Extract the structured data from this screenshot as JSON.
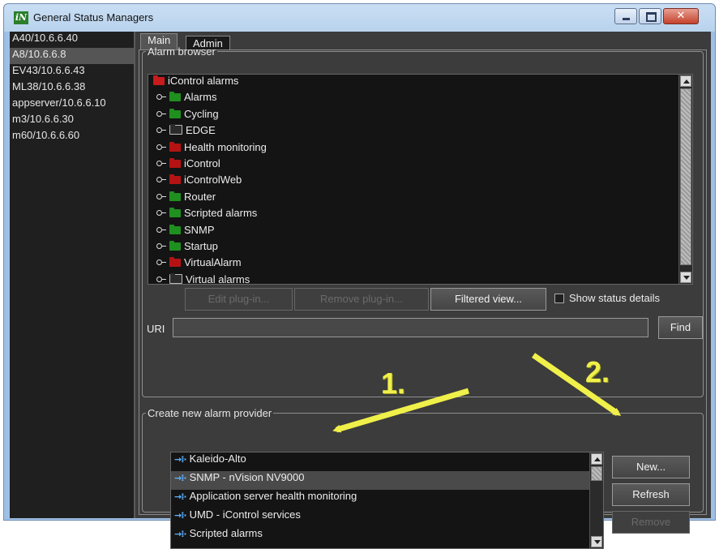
{
  "window": {
    "title": "General Status Managers",
    "app_icon": "iN"
  },
  "title_buttons": {
    "minimize": "minimize-icon",
    "maximize": "maximize-icon",
    "close": "close-icon"
  },
  "sidebar": {
    "items": [
      {
        "label": "A40/10.6.6.40"
      },
      {
        "label": "A8/10.6.6.8"
      },
      {
        "label": "EV43/10.6.6.43"
      },
      {
        "label": "ML38/10.6.6.38"
      },
      {
        "label": "appserver/10.6.6.10"
      },
      {
        "label": "m3/10.6.6.30"
      },
      {
        "label": "m60/10.6.6.60"
      }
    ],
    "selected": "A8/10.6.6.8"
  },
  "tabs": [
    {
      "label": "Main"
    },
    {
      "label": "Admin"
    }
  ],
  "browser": {
    "legend": "Alarm browser",
    "root": {
      "label": "iControl alarms",
      "color": "#c81b1b"
    },
    "items": [
      {
        "label": "Alarms",
        "color": "#1f8f1f"
      },
      {
        "label": "Cycling",
        "color": "#1f8f1f"
      },
      {
        "label": "EDGE",
        "color": "#2b2b2b"
      },
      {
        "label": "Health monitoring",
        "color": "#b51313"
      },
      {
        "label": "iControl",
        "color": "#b51313"
      },
      {
        "label": "iControlWeb",
        "color": "#b51313"
      },
      {
        "label": "Router",
        "color": "#1f8f1f"
      },
      {
        "label": "Scripted alarms",
        "color": "#1f8f1f"
      },
      {
        "label": "SNMP",
        "color": "#1f8f1f"
      },
      {
        "label": "Startup",
        "color": "#1f8f1f"
      },
      {
        "label": "VirtualAlarm",
        "color": "#b51313"
      },
      {
        "label": "Virtual alarms",
        "color": "#2b2b2b"
      }
    ],
    "buttons": {
      "edit": "Edit plug-in...",
      "remove": "Remove plug-in...",
      "filtered": "Filtered view..."
    },
    "show_status_details": {
      "label": "Show status details",
      "checked": false
    },
    "uri": {
      "label": "URI",
      "value": ""
    },
    "find": "Find"
  },
  "create": {
    "legend": "Create new alarm provider",
    "providers": [
      {
        "label": "Kaleido-Alto"
      },
      {
        "label": "SNMP - nVision NV9000"
      },
      {
        "label": "Application server health monitoring"
      },
      {
        "label": "UMD - iControl services"
      },
      {
        "label": "Scripted alarms"
      }
    ],
    "selected": "SNMP - nVision NV9000",
    "buttons": {
      "new": "New...",
      "refresh": "Refresh",
      "remove": "Remove"
    }
  },
  "annotations": {
    "step1": "1.",
    "step2": "2.",
    "color": "#f0f04a"
  }
}
